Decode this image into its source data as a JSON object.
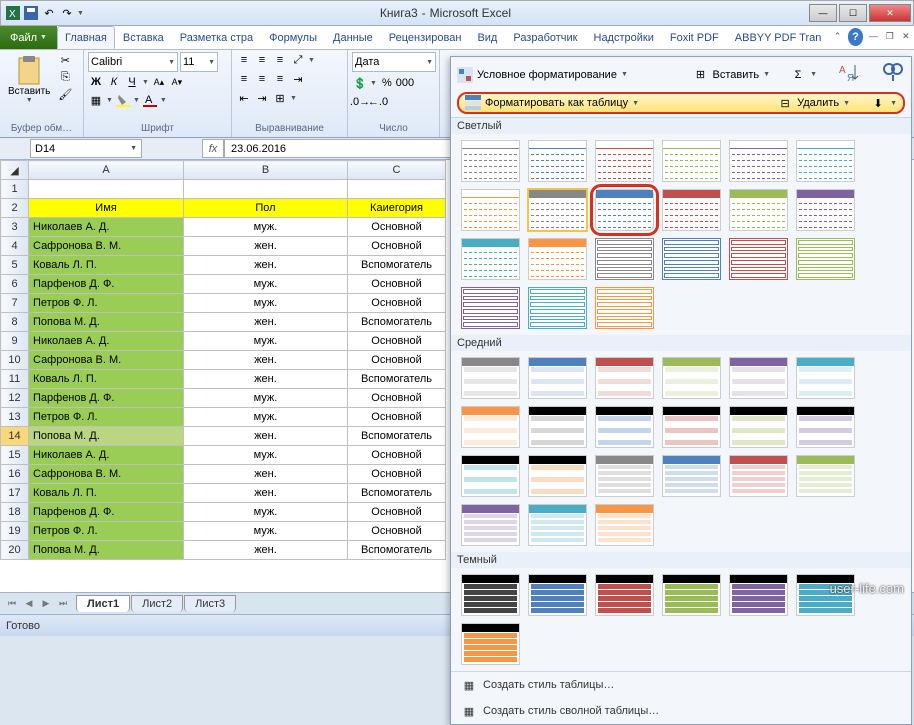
{
  "title": {
    "doc": "Книга3",
    "app": "Microsoft Excel"
  },
  "tabs": [
    "Главная",
    "Вставка",
    "Разметка стра",
    "Формулы",
    "Данные",
    "Рецензирован",
    "Вид",
    "Разработчик",
    "Надстройки",
    "Foxit PDF",
    "ABBYY PDF Tran"
  ],
  "file_tab": "Файл",
  "ribbon": {
    "clipboard": {
      "label": "Буфер обм…",
      "paste": "Вставить"
    },
    "font": {
      "label": "Шрифт",
      "name": "Calibri",
      "size": "11"
    },
    "align": {
      "label": "Выравнивание"
    },
    "number": {
      "label": "Число",
      "format": "Дата"
    },
    "styles": {
      "conditional": "Условное форматирование",
      "format_table": "Форматировать как таблицу"
    },
    "cells": {
      "insert": "Вставить",
      "delete": "Удалить"
    }
  },
  "namebox": "D14",
  "formula": "23.06.2016",
  "columns": [
    "A",
    "B",
    "C"
  ],
  "headers": {
    "a": "Имя",
    "b": "Пол",
    "c": "Каиегория"
  },
  "rows": [
    {
      "n": 3,
      "a": "Николаев А. Д.",
      "b": "муж.",
      "c": "Основной"
    },
    {
      "n": 4,
      "a": "Сафронова В. М.",
      "b": "жен.",
      "c": "Основной"
    },
    {
      "n": 5,
      "a": "Коваль Л. П.",
      "b": "жен.",
      "c": "Вспомогатель"
    },
    {
      "n": 6,
      "a": "Парфенов Д. Ф.",
      "b": "муж.",
      "c": "Основной"
    },
    {
      "n": 7,
      "a": "Петров Ф. Л.",
      "b": "муж.",
      "c": "Основной"
    },
    {
      "n": 8,
      "a": "Попова М. Д.",
      "b": "жен.",
      "c": "Вспомогатель"
    },
    {
      "n": 9,
      "a": "Николаев А. Д.",
      "b": "муж.",
      "c": "Основной"
    },
    {
      "n": 10,
      "a": "Сафронова В. М.",
      "b": "жен.",
      "c": "Основной"
    },
    {
      "n": 11,
      "a": "Коваль Л. П.",
      "b": "жен.",
      "c": "Вспомогатель"
    },
    {
      "n": 12,
      "a": "Парфенов Д. Ф.",
      "b": "муж.",
      "c": "Основной"
    },
    {
      "n": 13,
      "a": "Петров Ф. Л.",
      "b": "муж.",
      "c": "Основной"
    },
    {
      "n": 14,
      "a": "Попова М. Д.",
      "b": "жен.",
      "c": "Вспомогатель",
      "sel": true
    },
    {
      "n": 15,
      "a": "Николаев А. Д.",
      "b": "муж.",
      "c": "Основной"
    },
    {
      "n": 16,
      "a": "Сафронова В. М.",
      "b": "жен.",
      "c": "Основной"
    },
    {
      "n": 17,
      "a": "Коваль Л. П.",
      "b": "жен.",
      "c": "Вспомогатель"
    },
    {
      "n": 18,
      "a": "Парфенов Д. Ф.",
      "b": "муж.",
      "c": "Основной"
    },
    {
      "n": 19,
      "a": "Петров Ф. Л.",
      "b": "муж.",
      "c": "Основной"
    },
    {
      "n": 20,
      "a": "Попова М. Д.",
      "b": "жен.",
      "c": "Вспомогатель"
    }
  ],
  "sheet_tabs": [
    "Лист1",
    "Лист2",
    "Лист3"
  ],
  "status": "Готово",
  "gallery": {
    "sections": {
      "light": "Светлый",
      "medium": "Средний",
      "dark": "Темный"
    },
    "light_colors": [
      "#888888",
      "#4f81bd",
      "#c0504d",
      "#9bbb59",
      "#8064a2",
      "#4bacc6",
      "#f79646"
    ],
    "medium_colors": [
      "#888888",
      "#4f81bd",
      "#c0504d",
      "#9bbb59",
      "#8064a2",
      "#4bacc6",
      "#f79646"
    ],
    "dark_colors": [
      "#444444",
      "#4f81bd",
      "#c0504d",
      "#9bbb59",
      "#8064a2",
      "#4bacc6",
      "#f79646"
    ],
    "footer1": "Создать стиль таблицы…",
    "footer2": "Создать стиль сволной таблицы…"
  },
  "watermark": "user-life.com"
}
